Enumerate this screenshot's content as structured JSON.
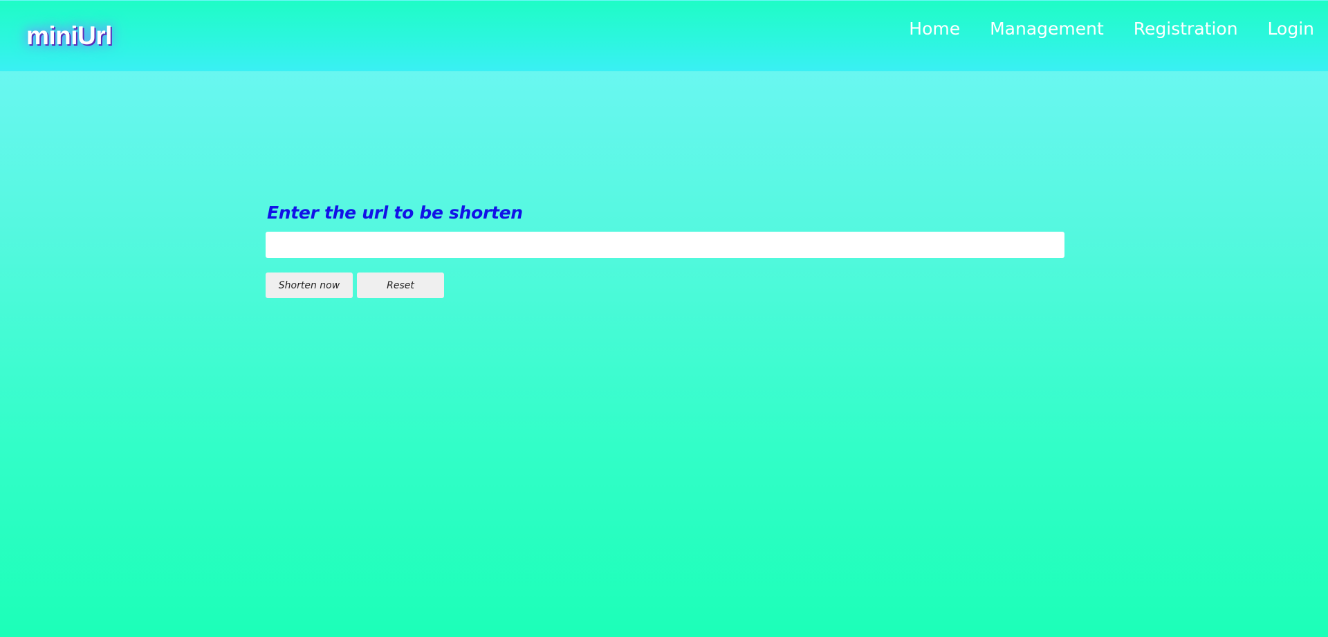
{
  "header": {
    "logo": "miniUrl",
    "nav": [
      "Home",
      "Management",
      "Registration",
      "Login"
    ]
  },
  "form": {
    "title": "Enter the url to be shorten",
    "input": {
      "value": "",
      "placeholder": ""
    },
    "buttons": {
      "shorten": "Shorten now",
      "reset": "Reset"
    }
  },
  "colors": {
    "title": "#1212e6",
    "header": "#2cf6de",
    "background_top": "#72f6f8",
    "background_bottom": "#1cffb8"
  }
}
